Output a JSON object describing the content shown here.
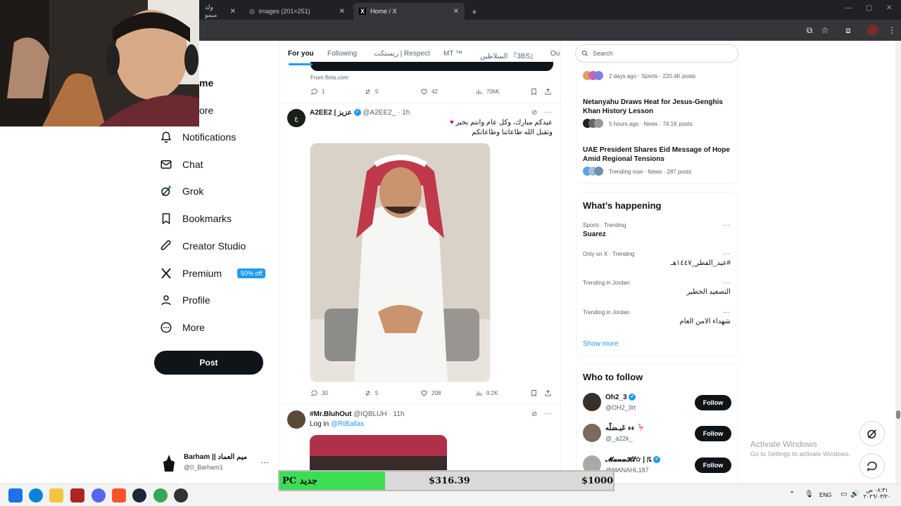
{
  "browser": {
    "tabs": [
      {
        "label": "ولد ميمو"
      },
      {
        "label": "images (201×251)"
      },
      {
        "label": "Home / X"
      }
    ]
  },
  "nav": {
    "partial_home": "me",
    "partial_explore": "ore",
    "items": [
      "Notifications",
      "Chat",
      "Grok",
      "Bookmarks",
      "Creator Studio",
      "Premium",
      "Profile",
      "More"
    ],
    "premium_badge": "50% off",
    "post_label": "Post",
    "account_name": "Barham || ميم العماد",
    "account_handle": "@0_Barham1"
  },
  "feed": {
    "tabs": [
      "For you",
      "Following",
      "ريستكت | Respect",
      "MT ™",
      "السلاطين 『3BS』",
      "Ou"
    ],
    "prev_post": {
      "source": "From ftmo.com",
      "replies": "1",
      "reposts": "5",
      "likes": "42",
      "views": "706K"
    },
    "post1": {
      "name": "A2EE2 | عزيز",
      "handle": "@A2EE2_",
      "time": "· 1h",
      "line1": "عيدكم مبارك، وكل عام وانتم بخير",
      "line2": "وتقبل الله طاعاتنا وطاعاتكم",
      "replies": "30",
      "reposts": "5",
      "likes": "208",
      "views": "9.2K"
    },
    "post2": {
      "name": "#Mr.BluhOut",
      "handle": "@IQBLUH",
      "time": "· 11h",
      "text_prefix": "Log in",
      "mention": "@RtBallas"
    }
  },
  "right": {
    "search_placeholder": "Search",
    "news": [
      {
        "title": "",
        "meta": "2 days ago · Sports · 220.4K posts"
      },
      {
        "title": "Netanyahu Draws Heat for Jesus-Genghis Khan History Lesson",
        "meta": "5 hours ago · News · 74.1K posts"
      },
      {
        "title": "UAE President Shares Eid Message of Hope Amid Regional Tensions",
        "meta": "Trending now · News · 287 posts"
      }
    ],
    "happening_title": "What’s happening",
    "trends": [
      {
        "meta": "Sports · Trending",
        "title": "Suarez"
      },
      {
        "meta": "Only on X · Trending",
        "title": "#عيد_الفطر_١٤٤٧هـ"
      },
      {
        "meta": "Trending in Jordan",
        "title": "التصعيد الخطير"
      },
      {
        "meta": "Trending in Jordan",
        "title": "شهداء الامن العام"
      }
    ],
    "show_more": "Show more",
    "who_title": "Who to follow",
    "follow": [
      {
        "name": "Oh2_3",
        "handle": "@OH2_3rt"
      },
      {
        "name": "ءء عَبـضلّه 🦩",
        "handle": "@_a22k_"
      },
      {
        "name": "𝓜𝓪𝓷𝓪𝓗𝓵☆ | ☈",
        "handle": "@MANAHL187"
      }
    ],
    "follow_label": "Follow"
  },
  "donation": {
    "label": "PC جديد",
    "current": "$316.39",
    "goal": "$1000",
    "progress": 0.316
  },
  "watermark": {
    "title": "Activate Windows",
    "subtitle": "Go to Settings to activate Windows."
  },
  "taskbar": {
    "lang": "ENG",
    "time": "٠٨:٣١ ص",
    "date": "٢٠٢٦/٠٣/٢٠"
  },
  "colors": {
    "accent": "#1d9bf0",
    "dark": "#0f1419",
    "muted": "#536471",
    "donation_fill": "#3ddc55"
  }
}
